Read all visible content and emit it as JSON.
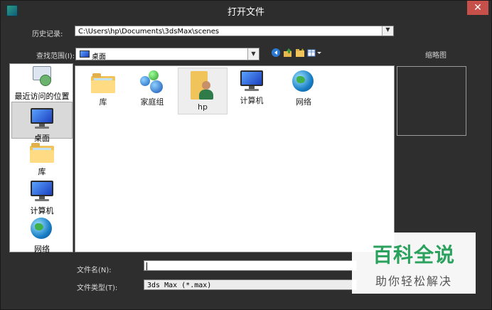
{
  "window": {
    "title": "打开文件",
    "close_glyph": "✕"
  },
  "history": {
    "label": "历史记录:",
    "value": "C:\\Users\\hp\\Documents\\3dsMax\\scenes"
  },
  "lookin": {
    "label": "查找范围(I):",
    "value": "桌面",
    "icon": "desktop-icon"
  },
  "toolbar": {
    "icons": [
      "back-icon",
      "up-folder-icon",
      "new-folder-icon",
      "view-menu-icon"
    ]
  },
  "places": [
    {
      "label": "最近访问的位置",
      "icon": "recent-places-icon"
    },
    {
      "label": "桌面",
      "icon": "desktop-icon",
      "selected": true
    },
    {
      "label": "库",
      "icon": "library-folder-icon"
    },
    {
      "label": "计算机",
      "icon": "computer-icon"
    },
    {
      "label": "网络",
      "icon": "network-globe-icon"
    }
  ],
  "files": [
    {
      "label": "库",
      "icon": "library-folder-icon"
    },
    {
      "label": "家庭组",
      "icon": "homegroup-icon"
    },
    {
      "label": "hp",
      "icon": "user-folder-icon",
      "selected": true
    },
    {
      "label": "计算机",
      "icon": "computer-icon"
    },
    {
      "label": "网络",
      "icon": "network-globe-icon"
    }
  ],
  "preview": {
    "label": "缩略图"
  },
  "filename": {
    "label": "文件名(N):",
    "value": ""
  },
  "filetype": {
    "label": "文件类型(T):",
    "value": "3ds Max (*.max)"
  },
  "watermark": {
    "main": "百科全说",
    "sub": "助你轻松解决"
  }
}
